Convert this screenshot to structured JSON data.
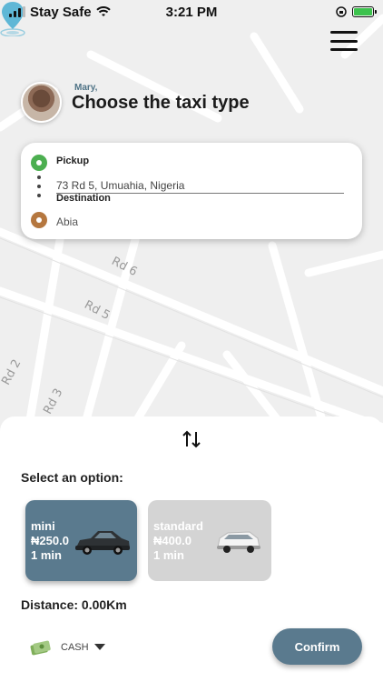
{
  "status_bar": {
    "carrier": "Stay Safe",
    "time": "3:21 PM"
  },
  "header": {
    "user_name": "Mary,",
    "title": "Choose the taxi type"
  },
  "address": {
    "pickup_label": "Pickup",
    "pickup_value": "73 Rd 5, Umuahia, Nigeria",
    "destination_label": "Destination",
    "destination_value": "Abia"
  },
  "map": {
    "roads": [
      "Rd 6",
      "Rd 5",
      "Rd 2",
      "Rd 3"
    ]
  },
  "options": {
    "label": "Select an option:",
    "items": [
      {
        "name": "mini",
        "price": "₦250.0",
        "eta": "1 min",
        "selected": true
      },
      {
        "name": "standard",
        "price": "₦400.0",
        "eta": "1 min",
        "selected": false
      }
    ]
  },
  "distance": "Distance: 0.00Km",
  "payment": {
    "method": "CASH"
  },
  "confirm_label": "Confirm",
  "colors": {
    "accent": "#5a7a8e",
    "pickup": "#4caf50",
    "destination": "#b5773f",
    "location_pin": "#5fb7d6"
  }
}
